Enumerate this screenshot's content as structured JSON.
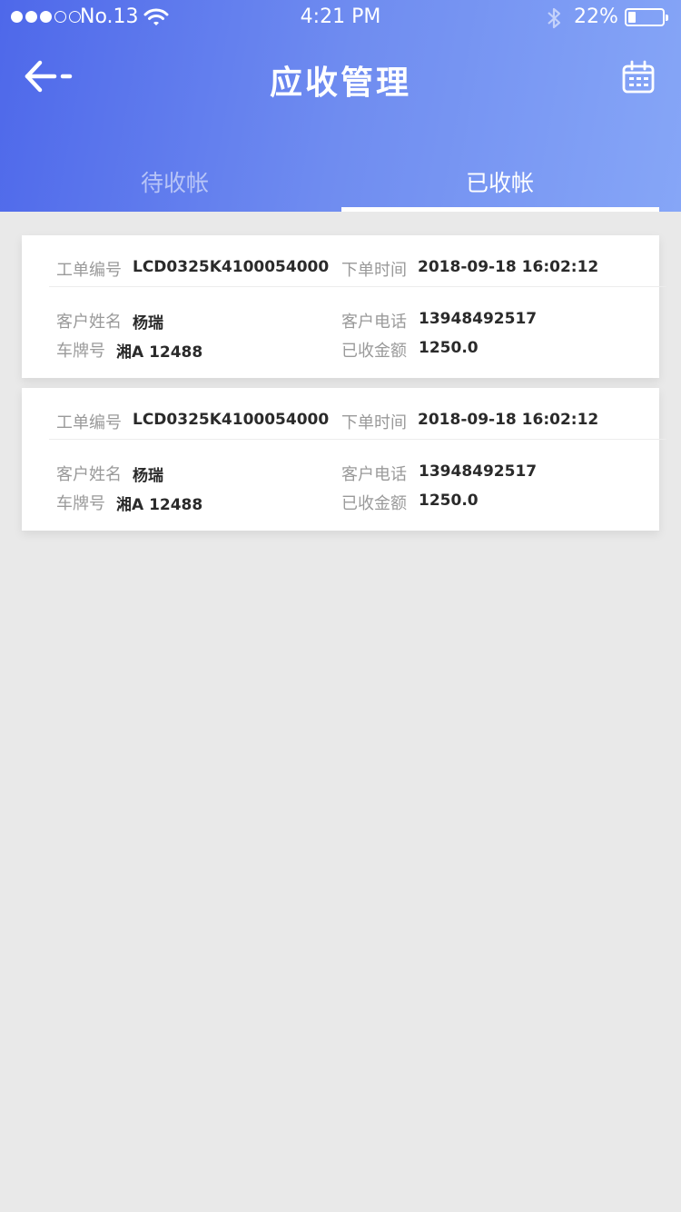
{
  "status_bar": {
    "carrier": "No.13",
    "time": "4:21 PM",
    "battery_pct": "22%",
    "battery_level": 0.22,
    "signal_bars_filled": 3
  },
  "header": {
    "title": "应收管理",
    "back_icon": "back-arrow-icon",
    "calendar_icon": "calendar-icon"
  },
  "tabs": [
    {
      "label": "待收帐",
      "active": false
    },
    {
      "label": "已收帐",
      "active": true
    }
  ],
  "colors": {
    "header_gradient_start": "#4e68ea",
    "header_gradient_end": "#86a6f7",
    "background": "#e9e9e9",
    "label_gray": "#9a9a9a"
  },
  "field_labels": {
    "order_no": "工单编号",
    "order_time": "下单时间",
    "customer_name": "客户姓名",
    "customer_phone": "客户电话",
    "plate": "车牌号",
    "received_amount": "已收金额"
  },
  "orders": [
    {
      "order_no": "LCD0325K4100054000",
      "order_time": "2018-09-18 16:02:12",
      "customer_name": "杨瑞",
      "customer_phone": "13948492517",
      "plate": "湘A 12488",
      "received_amount": "1250.0"
    },
    {
      "order_no": "LCD0325K4100054000",
      "order_time": "2018-09-18 16:02:12",
      "customer_name": "杨瑞",
      "customer_phone": "13948492517",
      "plate": "湘A 12488",
      "received_amount": "1250.0"
    }
  ]
}
